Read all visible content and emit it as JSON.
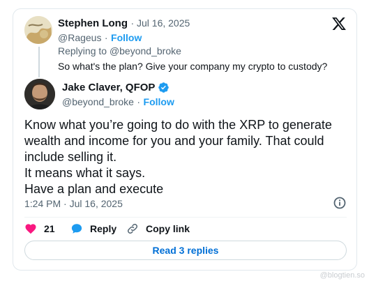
{
  "parent_tweet": {
    "author_name": "Stephen Long",
    "date": "· Jul 16, 2025",
    "handle": "@Rageus",
    "follow_label": "Follow",
    "replying_prefix": "Replying to ",
    "replying_handle": "@beyond_broke",
    "text": "So what's the plan? Give your company my crypto to custody?"
  },
  "tweet": {
    "author_name": "Jake Claver, QFOP",
    "handle": "@beyond_broke",
    "follow_label": "Follow",
    "separator": "·",
    "body_lines": [
      "Know what you’re going to do with the XRP to generate",
      "wealth and income for you and your family. That could",
      "include selling it.",
      "It means what it says.",
      "Have a plan and execute"
    ],
    "timestamp": "1:24 PM · Jul 16, 2025"
  },
  "actions": {
    "like_count": "21",
    "reply_label": "Reply",
    "copy_link_label": "Copy link"
  },
  "read_replies_label": "Read 3 replies",
  "watermark": "@blogtien.so",
  "colors": {
    "accent": "#1d9bf0",
    "like": "#f91880",
    "text": "#0f1419",
    "muted": "#536471"
  },
  "icons": [
    "x-logo-icon",
    "verified-badge-icon",
    "info-icon",
    "heart-icon",
    "reply-bubble-icon",
    "link-icon"
  ]
}
